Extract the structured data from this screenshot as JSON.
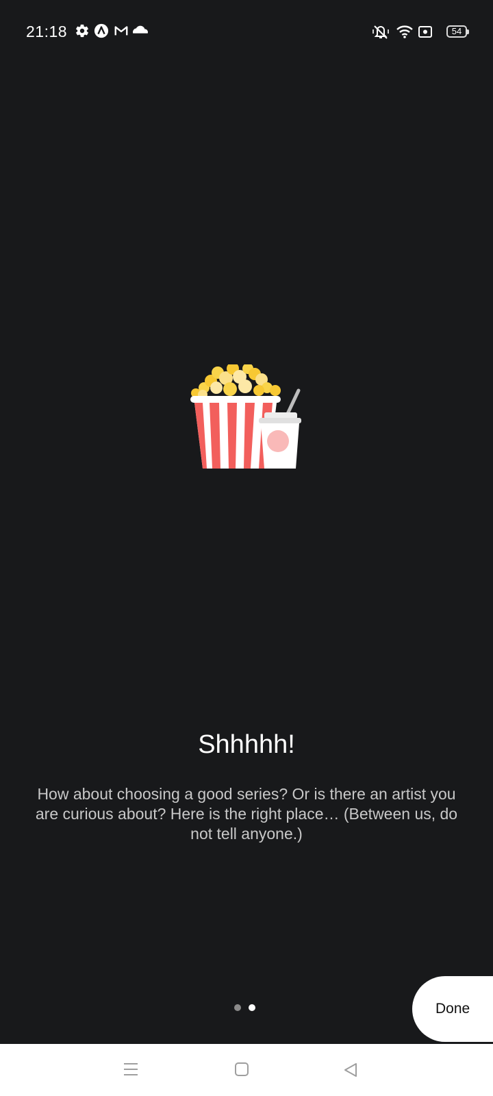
{
  "status_bar": {
    "time": "21:18",
    "left_icons": [
      "gear-icon",
      "vpn-a-icon",
      "gmail-icon",
      "cloud-icon"
    ],
    "right_icons": [
      "vibrate-mute-icon",
      "wifi-icon",
      "screen-record-icon",
      "battery-icon"
    ],
    "battery_level": "54"
  },
  "main": {
    "illustration": "popcorn-and-soda",
    "title": "Shhhhh!",
    "description": "How about choosing a good series? Or is there an artist you are curious about? Here is the right place… (Between us, do not tell anyone.)"
  },
  "pager": {
    "pages": 2,
    "active_page": 2
  },
  "done_label": "Done",
  "nav_bar": {
    "items": [
      "menu-icon",
      "home-icon",
      "back-icon"
    ]
  },
  "colors": {
    "background": "#18191b",
    "popcorn_red": "#f25f5c",
    "popcorn_yellow": "#f9d44a"
  }
}
